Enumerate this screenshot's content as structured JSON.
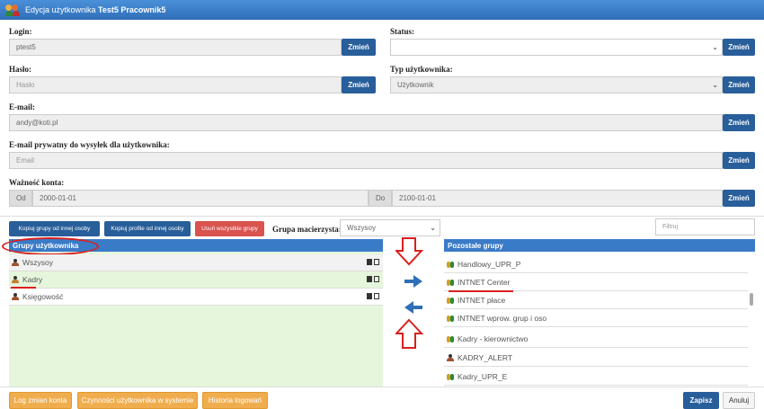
{
  "window": {
    "title_prefix": "Edycja użytkownika ",
    "title_user": "Test5 Pracownik5"
  },
  "form": {
    "login": {
      "label": "Login:",
      "value": "ptest5",
      "button": "Zmień"
    },
    "status": {
      "label": "Status:",
      "value": "",
      "button": "Zmień"
    },
    "password": {
      "label": "Hasło:",
      "placeholder": "Hasło",
      "button": "Zmień"
    },
    "user_type": {
      "label": "Typ użytkownika:",
      "value": "Użytkownik",
      "button": "Zmień"
    },
    "email": {
      "label": "E-mail:",
      "value": "andy@koti.pl",
      "button": "Zmień"
    },
    "email_private": {
      "label": "E-mail prywatny do wysyłek dla użytkownika:",
      "placeholder": "Email",
      "button": "Zmień"
    },
    "validity": {
      "label": "Ważność konta:",
      "from_label": "Od",
      "from_value": "2000-01-01",
      "to_label": "Do",
      "to_value": "2100-01-01",
      "button": "Zmień"
    }
  },
  "toolbar": {
    "copy_groups": "Kopiuj grupy od innej osoby",
    "copy_profile": "Kopiuj profile od innej osoby",
    "remove_all": "Usuń wszystkie grupy",
    "parent_group_label": "Grupa macierzysta:",
    "parent_group_value": "Wszysoy",
    "filter_placeholder": "Filtruj"
  },
  "user_groups": {
    "header": "Grupy użytkownika",
    "items": [
      "Wszysoy",
      "Kadry",
      "Księgowość"
    ]
  },
  "other_groups": {
    "header": "Pozostałe grupy",
    "items": [
      "Handlowy_UPR_P",
      "INTNET Center",
      "INTNET płace",
      "INTNET wprow. grup i oso",
      "Kadry - kierownictwo",
      "KADRY_ALERT",
      "Kadry_UPR_E"
    ]
  },
  "footer": {
    "log_changes": "Log zmian konta",
    "user_actions": "Czynności użytkownika w systemie",
    "login_history": "Historia logowań",
    "save": "Zapisz",
    "cancel": "Anuluj"
  },
  "colors": {
    "accent_blue": "#285e9a",
    "header_blue": "#3a7bc8",
    "orange": "#f0ad4e",
    "red": "#d9534f",
    "annotation_red": "#d9201e",
    "group_bg": "#e6f6dc"
  }
}
